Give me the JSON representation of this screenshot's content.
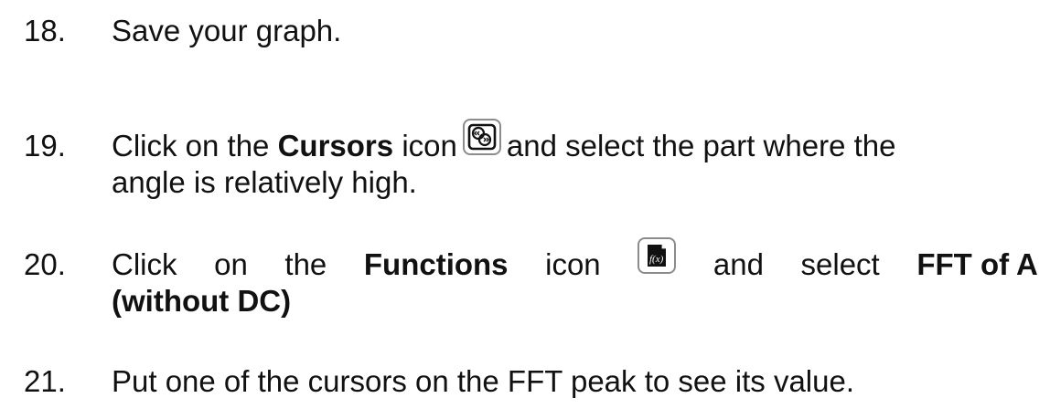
{
  "steps": [
    {
      "number": "18.",
      "text": "Save your graph."
    },
    {
      "number": "19.",
      "pre": "Click on the",
      "bold": "Cursors",
      "mid": "icon",
      "icon": "cursors-icon",
      "post": "and select the part where the",
      "line2": "angle is relatively high."
    },
    {
      "number": "20.",
      "w1": "Click",
      "w2": "on",
      "w3": "the",
      "bold": "Functions",
      "w4": "icon",
      "icon": "functions-icon",
      "w5": "and",
      "w6": "select",
      "bold2": "FFT of A",
      "line2_bold": "(without DC)"
    },
    {
      "number": "21.",
      "text": "Put one of the cursors on the FFT peak to see its value."
    }
  ]
}
